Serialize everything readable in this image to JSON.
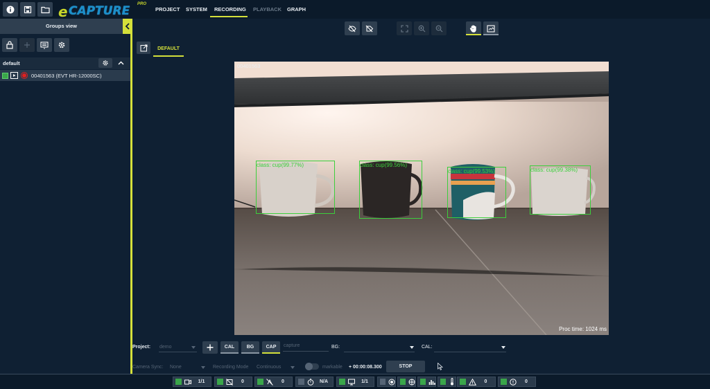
{
  "app": {
    "logo_e": "e",
    "logo_text": "CAPTURE",
    "logo_pro": "PRO"
  },
  "menu": [
    {
      "label": "PROJECT",
      "state": "normal"
    },
    {
      "label": "SYSTEM",
      "state": "normal"
    },
    {
      "label": "RECORDING",
      "state": "active"
    },
    {
      "label": "PLAYBACK",
      "state": "disabled"
    },
    {
      "label": "GRAPH",
      "state": "normal"
    }
  ],
  "sidebar": {
    "title": "Groups view",
    "group_name": "default",
    "camera_label": "00401563 (EVT HR-12000SC)"
  },
  "view": {
    "tab_label": "DEFAULT",
    "camera_title": "00401563",
    "proc_time": "Proc time: 1024 ms",
    "detections": [
      {
        "label": "class: cup(99.77%)"
      },
      {
        "label": "class: cup(99.56%)"
      },
      {
        "label": "class: cup(99.53%)"
      },
      {
        "label": "class: cup(99.38%)"
      }
    ]
  },
  "controls": {
    "project_label": "Project:",
    "project_value": "demo",
    "cal_btn": "CAL",
    "bg_btn": "BG",
    "cap_btn": "CAP",
    "capture_placeholder": "capture",
    "bg_label": "BG:",
    "cal_label": "CAL:",
    "camera_sync_label": "Camera Sync:",
    "camera_sync_value": "None",
    "recording_mode_label": "Recording Mode",
    "recording_mode_value": "Continuous",
    "markable_label": "markable",
    "timer": "+ 00:00:08.300",
    "stop_btn": "STOP"
  },
  "status": [
    {
      "icon": "camera-icon",
      "value": "1/1"
    },
    {
      "icon": "no-display-icon",
      "value": "0"
    },
    {
      "icon": "no-frames-icon",
      "value": "0"
    },
    {
      "icon": "stopwatch-icon",
      "value": "N/A"
    },
    {
      "icon": "monitor-icon",
      "value": "1/1"
    },
    {
      "icon": "record-icon",
      "value": ""
    },
    {
      "icon": "network-icon",
      "value": ""
    },
    {
      "icon": "bar-chart-icon",
      "value": ""
    },
    {
      "icon": "thermometer-icon",
      "value": ""
    },
    {
      "icon": "warning-icon",
      "value": "0"
    },
    {
      "icon": "error-icon",
      "value": "0"
    }
  ],
  "colors": {
    "accent": "#d4e03a",
    "background": "#0f2033",
    "panel": "#2f3f50",
    "status_green": "#3aa64a",
    "detection_box": "#3ccf3c",
    "record_red": "#e02020"
  }
}
